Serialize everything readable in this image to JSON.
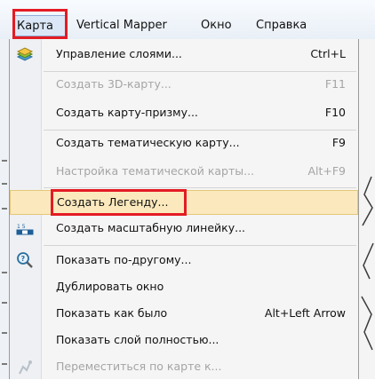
{
  "menubar": {
    "items": [
      "Карта",
      "Vertical Mapper",
      "Окно",
      "Справка"
    ]
  },
  "menu": {
    "items": [
      {
        "label": "Управление слоями...",
        "shortcut": "Ctrl+L",
        "disabled": false,
        "icon": "layers-icon"
      },
      {
        "label": "Создать 3D-карту...",
        "shortcut": "F11",
        "disabled": true
      },
      {
        "label": "Создать карту-призму...",
        "shortcut": "F10",
        "disabled": false
      },
      {
        "label": "Создать тематическую карту...",
        "shortcut": "F9",
        "disabled": false
      },
      {
        "label": "Настройка тематической карты...",
        "shortcut": "Alt+F9",
        "disabled": true
      },
      {
        "label": "Создать Легенду...",
        "shortcut": "",
        "disabled": false,
        "highlighted": true
      },
      {
        "label": "Создать масштабную линейку...",
        "shortcut": "",
        "disabled": false,
        "icon": "scale-bar-icon"
      },
      {
        "label": "Показать по-другому...",
        "shortcut": "",
        "disabled": false,
        "icon": "zoom-icon"
      },
      {
        "label": "Дублировать окно",
        "shortcut": "",
        "disabled": false
      },
      {
        "label": "Показать как было",
        "shortcut": "Alt+Left Arrow",
        "disabled": false
      },
      {
        "label": "Показать слой полностью...",
        "shortcut": "",
        "disabled": false
      },
      {
        "label": "Переместиться по карте к...",
        "shortcut": "",
        "disabled": true,
        "icon": "pan-icon"
      }
    ]
  },
  "colors": {
    "highlight_fill": "#fbe9bd",
    "annotation_red": "#e41b24"
  }
}
